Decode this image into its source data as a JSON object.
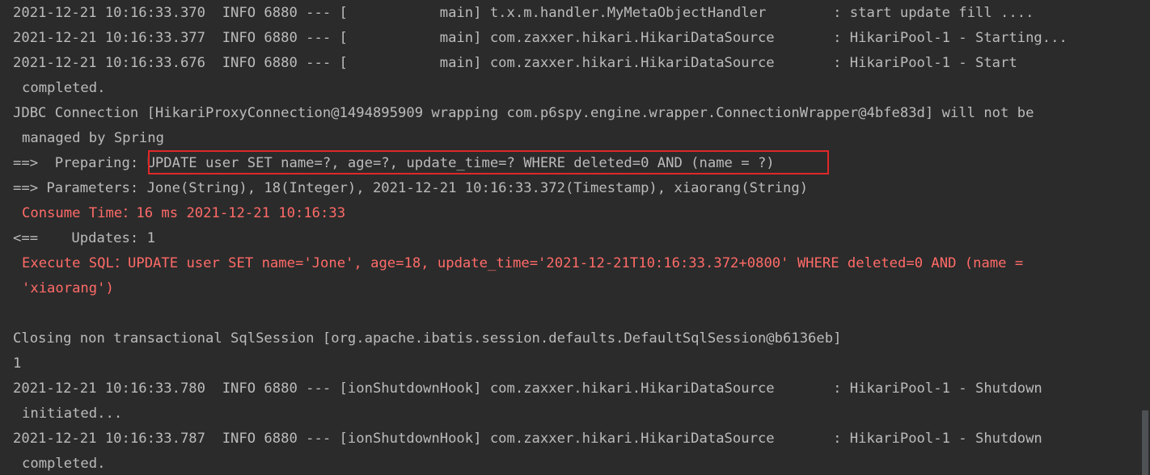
{
  "console": {
    "lines": [
      "2021-12-21 10:16:33.370  INFO 6880 --- [           main] t.x.m.handler.MyMetaObjectHandler        : start update fill ....",
      "2021-12-21 10:16:33.377  INFO 6880 --- [           main] com.zaxxer.hikari.HikariDataSource       : HikariPool-1 - Starting...",
      "2021-12-21 10:16:33.676  INFO 6880 --- [           main] com.zaxxer.hikari.HikariDataSource       : HikariPool-1 - Start",
      "completed.",
      "JDBC Connection [HikariProxyConnection@1494895909 wrapping com.p6spy.engine.wrapper.ConnectionWrapper@4bfe83d] will not be",
      "managed by Spring",
      "==>  Preparing: UPDATE user SET name=?, age=?, update_time=? WHERE deleted=0 AND (name = ?)",
      "==> Parameters: Jone(String), 18(Integer), 2021-12-21 10:16:33.372(Timestamp), xiaorang(String)",
      "Consume Time：16 ms 2021-12-21 10:16:33",
      "<==    Updates: 1",
      "Execute SQL：UPDATE user SET name='Jone', age=18, update_time='2021-12-21T10:16:33.372+0800' WHERE deleted=0 AND (name =",
      "'xiaorang')",
      "",
      "Closing non transactional SqlSession [org.apache.ibatis.session.defaults.DefaultSqlSession@b6136eb]",
      "1",
      "2021-12-21 10:16:33.780  INFO 6880 --- [ionShutdownHook] com.zaxxer.hikari.HikariDataSource       : HikariPool-1 - Shutdown",
      "initiated...",
      "2021-12-21 10:16:33.787  INFO 6880 --- [ionShutdownHook] com.zaxxer.hikari.HikariDataSource       : HikariPool-1 - Shutdown",
      "completed."
    ]
  },
  "colors": {
    "background": "#2b2b2b",
    "text": "#bbbbbb",
    "error_text": "#ff6b68",
    "highlight_box": "#e02828"
  }
}
